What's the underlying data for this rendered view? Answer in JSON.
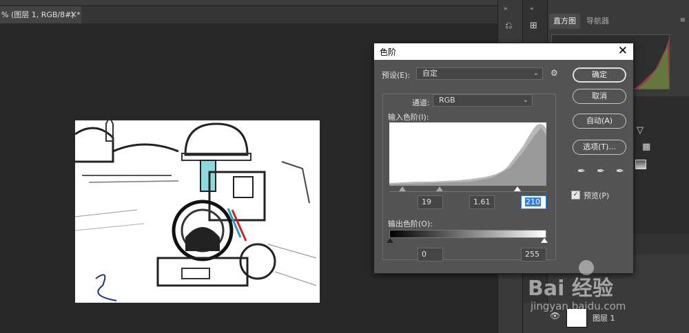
{
  "document_tab": {
    "title": "% (图层 1, RGB/8#) *",
    "close": "×"
  },
  "right_panel": {
    "tabs": [
      "直方图",
      "导航器"
    ],
    "layer": {
      "name": "图层 1"
    }
  },
  "levels_dialog": {
    "title": "色阶",
    "close": "✕",
    "preset_label": "预设(E):",
    "preset_value": "自定",
    "channel_label": "通道:",
    "channel_value": "RGB",
    "input_levels_label": "输入色阶(I):",
    "input_values": {
      "black": "19",
      "gamma": "1.61",
      "white": "210"
    },
    "output_levels_label": "输出色阶(O):",
    "output_values": {
      "black": "0",
      "white": "255"
    },
    "buttons": {
      "ok": "确定",
      "cancel": "取消",
      "auto": "自动(A)",
      "options": "选项(T)..."
    },
    "preview_label": "预览(P)",
    "preview_checked": true
  },
  "watermark": {
    "brand": "Bai 经验",
    "url": "jingyan.baidu.com"
  }
}
